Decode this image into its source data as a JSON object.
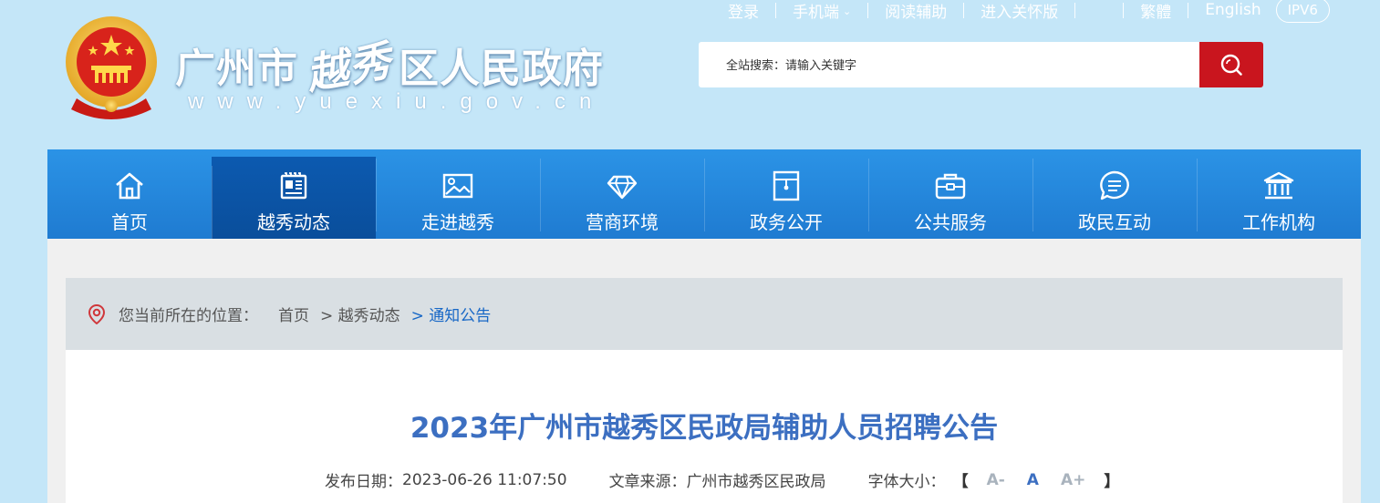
{
  "top_links": {
    "login": "登录",
    "mobile": "手机端",
    "mobile_caret": "⌄",
    "reading_aid": "阅读辅助",
    "elder_mode": "进入关怀版",
    "traditional": "繁體",
    "english": "English",
    "ipv6": "IPV6"
  },
  "header": {
    "title_prefix": "广州市",
    "title_script": "越秀",
    "title_suffix": "区人民政府",
    "domain": "www.yuexiu.gov.cn",
    "emblem_icon": "national-emblem-icon"
  },
  "search": {
    "placeholder": "全站搜索：请输入关键字",
    "button_icon": "search-icon"
  },
  "nav": {
    "items": [
      {
        "label": "首页",
        "icon": "home-icon"
      },
      {
        "label": "越秀动态",
        "icon": "newspaper-icon"
      },
      {
        "label": "走进越秀",
        "icon": "picture-icon"
      },
      {
        "label": "营商环境",
        "icon": "diamond-icon"
      },
      {
        "label": "政务公开",
        "icon": "document-folder-icon"
      },
      {
        "label": "公共服务",
        "icon": "briefcase-icon"
      },
      {
        "label": "政民互动",
        "icon": "chat-bubble-icon"
      },
      {
        "label": "工作机构",
        "icon": "institution-icon"
      }
    ],
    "active_index": 1
  },
  "breadcrumb": {
    "label": "您当前所在的位置：",
    "items": [
      "首页",
      "> 越秀动态",
      "> 通知公告"
    ]
  },
  "article": {
    "title": "2023年广州市越秀区民政局辅助人员招聘公告",
    "date_label": "发布日期：",
    "date": "2023-06-26 11:07:50",
    "source_label": "文章来源：",
    "source": "广州市越秀区民政局",
    "fontsize_label": "字体大小：",
    "bracket_open": "【",
    "bracket_close": "】",
    "font_small": "A-",
    "font_normal": "A",
    "font_large": "A+"
  },
  "colors": {
    "header_bg": "#c4e6f8",
    "nav_bg": "#2588dc",
    "nav_active": "#0c5ab0",
    "search_button": "#c9151e",
    "title_blue": "#3c6fc1"
  }
}
